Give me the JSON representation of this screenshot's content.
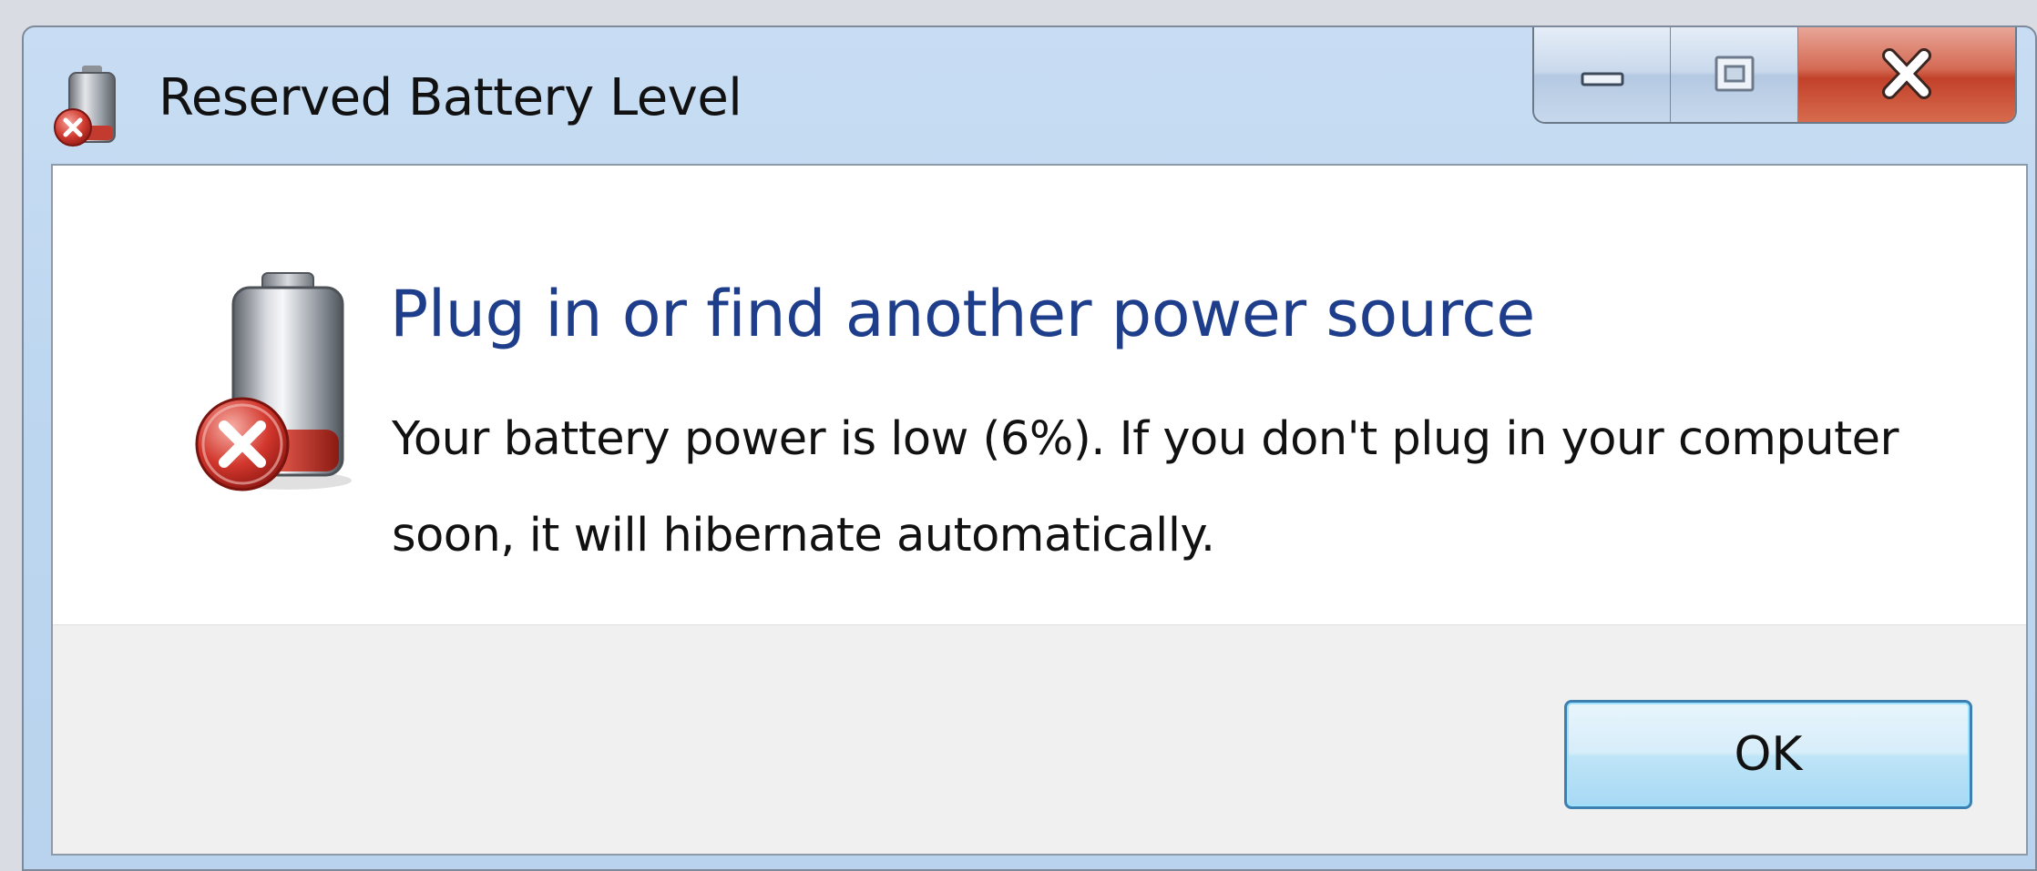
{
  "window": {
    "title": "Reserved Battery Level",
    "icon": "battery-error-icon"
  },
  "caption_buttons": {
    "minimize_icon": "minimize-icon",
    "maximize_icon": "maximize-icon",
    "close_icon": "close-icon"
  },
  "dialog": {
    "icon": "battery-error-icon",
    "heading": "Plug in or find another power source",
    "message": "Your battery power is low (6%). If you don't plug in your computer soon, it will hibernate automatically.",
    "ok_label": "OK"
  },
  "colors": {
    "heading": "#1e3e8c",
    "close_button": "#c2412a",
    "error_badge": "#c0302b",
    "ok_border": "#3c7fb1"
  }
}
